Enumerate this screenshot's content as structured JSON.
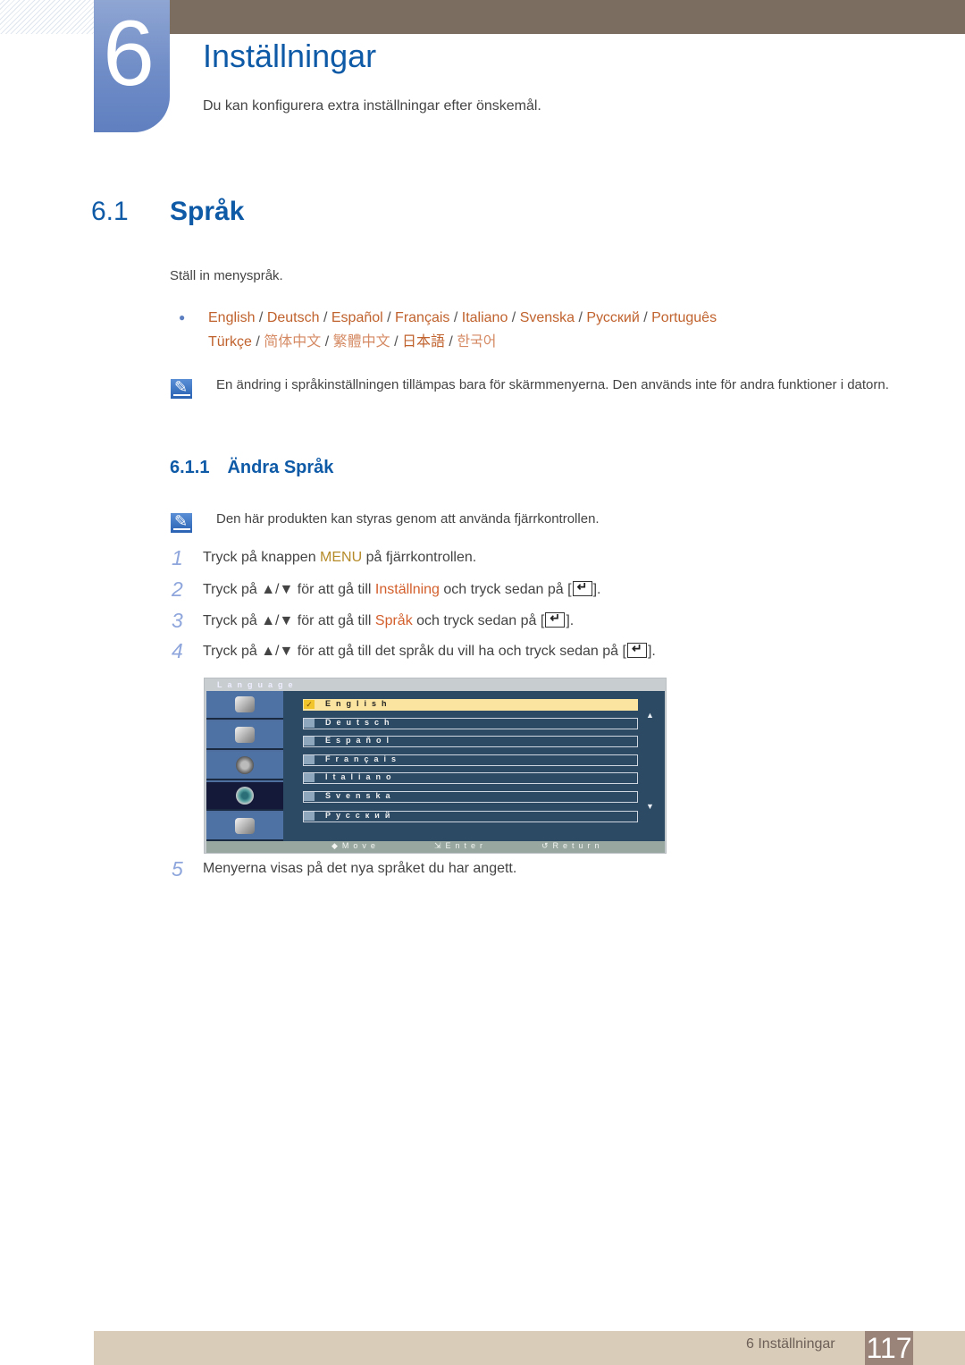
{
  "chapter": {
    "number": "6",
    "title": "Inställningar",
    "subtitle": "Du kan konfigurera extra inställningar efter önskemål."
  },
  "section": {
    "number": "6.1",
    "title": "Språk",
    "intro": "Ställ in menyspråk.",
    "languages_line1": [
      "English",
      "Deutsch",
      "Español",
      "Français",
      "Italiano",
      "Svenska",
      "Русский",
      "Português"
    ],
    "languages_line2": [
      "Türkçe",
      "简体中文",
      "繁體中文",
      "日本語",
      "한국어"
    ],
    "separator": " / ",
    "note": "En ändring i språkinställningen tillämpas bara för skärmmenyerna. Den används inte för andra funktioner i datorn."
  },
  "subsection": {
    "number": "6.1.1",
    "title": "Ändra Språk",
    "note": "Den här produkten kan styras genom att använda fjärrkontrollen.",
    "steps": [
      {
        "num": "1",
        "pre": "Tryck på knappen ",
        "hl": "MENU",
        "post": " på fjärrkontrollen."
      },
      {
        "num": "2",
        "pre": "Tryck på ▲/▼ för att gå till ",
        "hl": "Inställning",
        "post": " och tryck sedan på ["
      },
      {
        "num": "3",
        "pre": "Tryck på ▲/▼ för att gå till ",
        "hl": "Språk",
        "post": " och tryck sedan på ["
      },
      {
        "num": "4",
        "pre": "Tryck på ▲/▼ för att gå till det språk du vill ha och tryck sedan på [",
        "hl": "",
        "post": ""
      },
      {
        "num": "5",
        "pre": "Menyerna visas på det nya språket du har angett.",
        "hl": "",
        "post": ""
      }
    ],
    "bracket_close": "]."
  },
  "osd": {
    "title": "Language",
    "selected": "English",
    "items": [
      "English",
      "Deutsch",
      "Español",
      "Français",
      "Italiano",
      "Svenska",
      "Русский"
    ],
    "side_icons": [
      "input-icon",
      "picture-icon",
      "sound-icon",
      "setup-icon",
      "multi-screen-icon"
    ],
    "active_side": 3,
    "footer": {
      "move": "◆Move",
      "enter": "Enter",
      "return": "Return"
    },
    "checkmark": "✓",
    "scroll_up": "▲",
    "scroll_down": "▼"
  },
  "footer": {
    "label": "6 Inställningar",
    "page": "117"
  }
}
